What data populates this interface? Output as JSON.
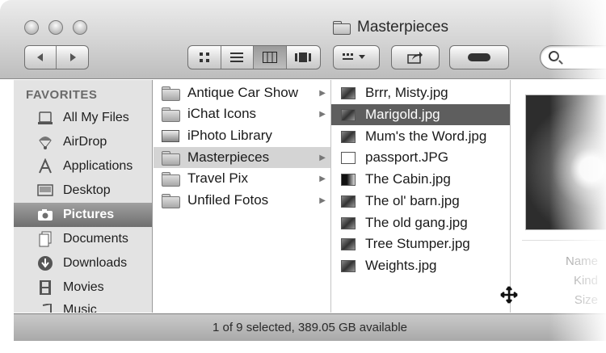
{
  "window": {
    "title": "Masterpieces"
  },
  "sidebar": {
    "heading": "FAVORITES",
    "items": [
      {
        "label": "All My Files",
        "icon": "all-files-icon"
      },
      {
        "label": "AirDrop",
        "icon": "airdrop-icon"
      },
      {
        "label": "Applications",
        "icon": "applications-icon"
      },
      {
        "label": "Desktop",
        "icon": "desktop-icon"
      },
      {
        "label": "Pictures",
        "icon": "pictures-icon",
        "selected": true
      },
      {
        "label": "Documents",
        "icon": "documents-icon"
      },
      {
        "label": "Downloads",
        "icon": "downloads-icon"
      },
      {
        "label": "Movies",
        "icon": "movies-icon"
      },
      {
        "label": "Music",
        "icon": "music-icon"
      }
    ]
  },
  "column1": {
    "items": [
      {
        "label": "Antique Car Show",
        "has_children": true
      },
      {
        "label": "iChat Icons",
        "has_children": true
      },
      {
        "label": "iPhoto Library",
        "has_children": false
      },
      {
        "label": "Masterpieces",
        "has_children": true,
        "selected": true
      },
      {
        "label": "Travel Pix",
        "has_children": true
      },
      {
        "label": "Unfiled Fotos",
        "has_children": true
      }
    ]
  },
  "column2": {
    "items": [
      {
        "label": "Brrr, Misty.jpg"
      },
      {
        "label": "Marigold.jpg",
        "selected": true
      },
      {
        "label": "Mum's the Word.jpg"
      },
      {
        "label": "passport.JPG"
      },
      {
        "label": "The Cabin.jpg"
      },
      {
        "label": "The ol' barn.jpg"
      },
      {
        "label": "The old gang.jpg"
      },
      {
        "label": "Tree Stumper.jpg"
      },
      {
        "label": "Weights.jpg"
      }
    ]
  },
  "preview": {
    "labels": [
      "Name",
      "Kind",
      "Size"
    ]
  },
  "status": {
    "text": "1 of 9 selected, 389.05 GB available"
  },
  "colors": {
    "selection_dark": "#5e5e5e",
    "selection_light": "#d4d4d4",
    "sidebar_bg": "#e3e3e3"
  }
}
